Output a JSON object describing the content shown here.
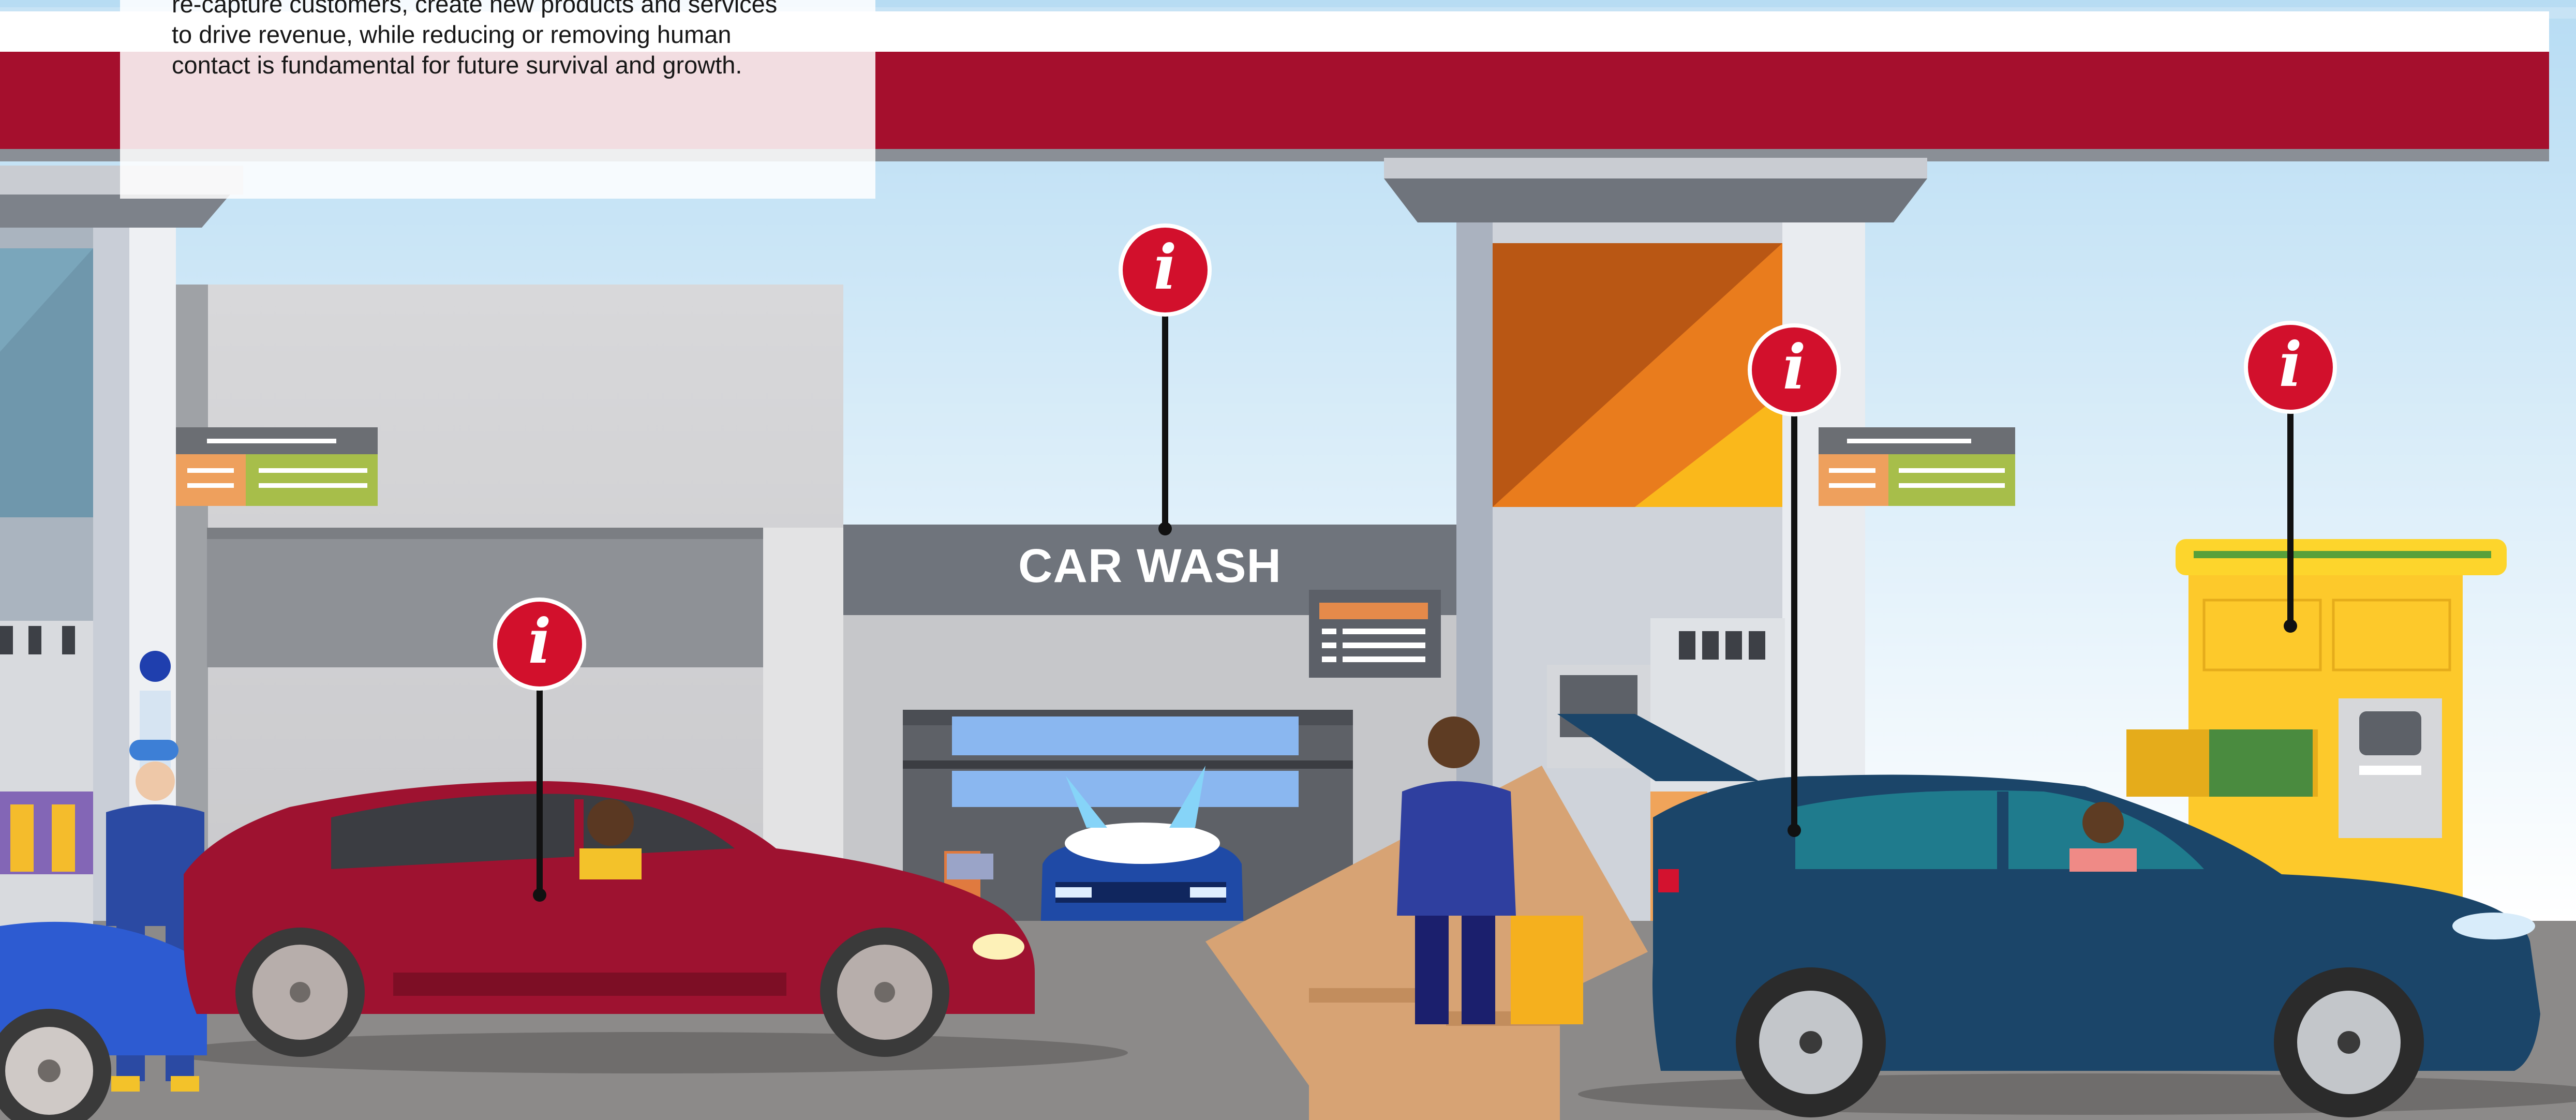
{
  "intro": {
    "lines": [
      "re-capture customers, create new products and services",
      "to drive revenue, while reducing or removing human",
      "contact is fundamental for future survival and growth."
    ]
  },
  "car_wash": {
    "sign_text": "CAR WASH"
  },
  "hotspots": [
    {
      "id": "info-car-at-pump",
      "glyph": "i"
    },
    {
      "id": "info-car-wash",
      "glyph": "i"
    },
    {
      "id": "info-kiosk-pillar",
      "glyph": "i"
    },
    {
      "id": "info-parcel-locker",
      "glyph": "i"
    }
  ],
  "colors": {
    "canopy_red": "#a50f2d",
    "pin_red": "#d2102c",
    "sky": "#d4e9f5",
    "locker_yellow": "#fdd52c",
    "red_car": "#9e1230",
    "navy_car": "#1b4569",
    "blue_car": "#2d5bd1",
    "ground": "#8c8a89"
  }
}
